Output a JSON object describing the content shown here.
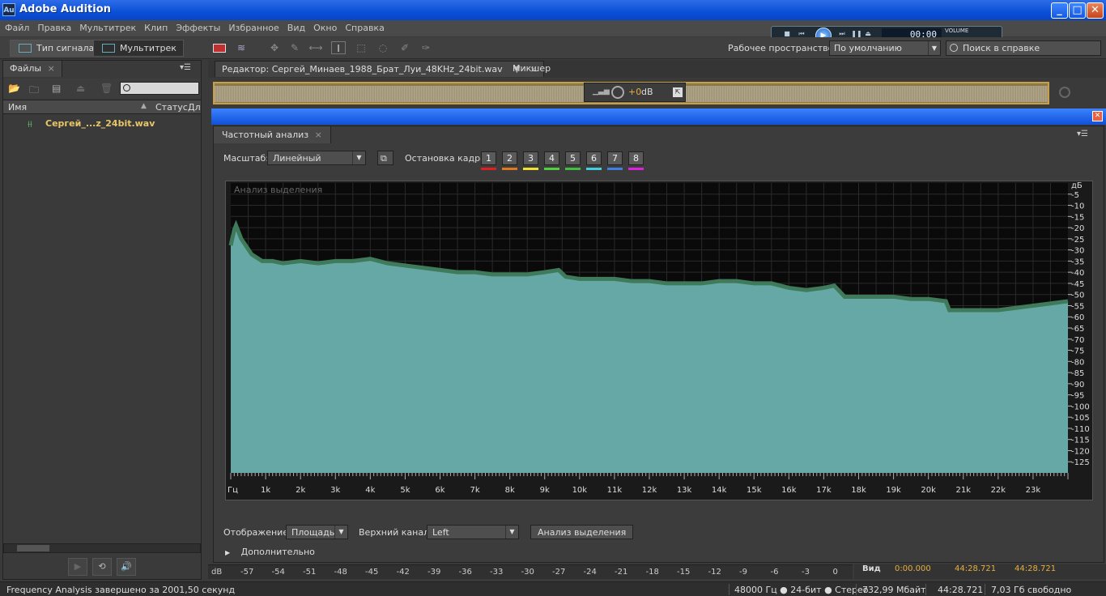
{
  "window": {
    "title": "Adobe Audition",
    "logo": "Au",
    "minimize": "_",
    "maximize": "□",
    "close": "✕"
  },
  "menu": [
    "Файл",
    "Правка",
    "Мультитрек",
    "Клип",
    "Эффекты",
    "Избранное",
    "Вид",
    "Окно",
    "Справка"
  ],
  "transport": {
    "time": "00:00",
    "volume_label": "VOLUME"
  },
  "toolbar": {
    "mode_waveform": "Тип сигнала",
    "mode_multitrack": "Мультитрек",
    "workspace_label": "Рабочее пространство:",
    "workspace_value": "По умолчанию",
    "help_placeholder": "Поиск в справке"
  },
  "files_panel": {
    "tab": "Файлы",
    "col_name": "Имя",
    "col_status": "Статус",
    "col_duration": "Дл",
    "file_name": "Сергей_...z_24bit.wav"
  },
  "editor": {
    "tab_editor": "Редактор: Сергей_Минаев_1988_Брат_Луи_48KHz_24bit.wav",
    "tab_mixer": "Микшер",
    "hud_gain": "+0",
    "hud_unit": "dB"
  },
  "freq_analysis": {
    "tab": "Частотный анализ",
    "scale_label": "Масштаб:",
    "scale_value": "Линейный",
    "hold_label": "Остановка кадра:",
    "hold_buttons": [
      "1",
      "2",
      "3",
      "4",
      "5",
      "6",
      "7",
      "8"
    ],
    "hold_colors": [
      "#e02020",
      "#e07820",
      "#f0e030",
      "#50d040",
      "#40c040",
      "#40d0e0",
      "#4080e0",
      "#e020e0"
    ],
    "chart_caption": "Анализ выделения",
    "display_label": "Отображение:",
    "display_value": "Площадь",
    "channel_label": "Верхний канал:",
    "channel_value": "Left",
    "analyze_button": "Анализ выделения",
    "advanced_label": "Дополнительно"
  },
  "chart_data": {
    "type": "area",
    "x_unit": "Гц",
    "y_unit": "дБ",
    "x_ticks": [
      "1k",
      "2k",
      "3k",
      "4k",
      "5k",
      "6k",
      "7k",
      "8k",
      "9k",
      "10k",
      "11k",
      "12k",
      "13k",
      "14k",
      "15k",
      "16k",
      "17k",
      "18k",
      "19k",
      "20k",
      "21k",
      "22k",
      "23k"
    ],
    "y_ticks": [
      "-5",
      "-10",
      "-15",
      "-20",
      "-25",
      "-30",
      "-35",
      "-40",
      "-45",
      "-50",
      "-55",
      "-60",
      "-65",
      "-70",
      "-75",
      "-80",
      "-85",
      "-90",
      "-95",
      "-100",
      "-105",
      "-110",
      "-115",
      "-120",
      "-125"
    ],
    "xlim": [
      0,
      24000
    ],
    "ylim": [
      -130,
      0
    ],
    "x": [
      0,
      100,
      150,
      300,
      600,
      900,
      1200,
      1500,
      2000,
      2500,
      3000,
      3500,
      4000,
      4500,
      5000,
      5500,
      6000,
      6500,
      7000,
      7500,
      8000,
      8500,
      9000,
      9400,
      9600,
      10000,
      10500,
      11000,
      11500,
      12000,
      12500,
      13000,
      13500,
      14000,
      14500,
      15000,
      15500,
      16000,
      16500,
      17000,
      17300,
      17600,
      18000,
      18500,
      19000,
      19500,
      20000,
      20500,
      20600,
      21000,
      21500,
      22000,
      22500,
      23000,
      23500,
      24000
    ],
    "y": [
      -28,
      -21,
      -19,
      -25,
      -32,
      -35,
      -35,
      -36,
      -35,
      -36,
      -35,
      -35,
      -34,
      -36,
      -37,
      -38,
      -39,
      -40,
      -40,
      -41,
      -41,
      -41,
      -40,
      -39,
      -42,
      -43,
      -43,
      -43,
      -44,
      -44,
      -45,
      -45,
      -45,
      -44,
      -44,
      -45,
      -45,
      -47,
      -48,
      -47,
      -46,
      -51,
      -51,
      -51,
      -51,
      -52,
      -52,
      -53,
      -57,
      -57,
      -57,
      -57,
      -56,
      -55,
      -54,
      -53
    ],
    "grid": true
  },
  "meter": {
    "unit": "dB",
    "ticks": [
      "-57",
      "-54",
      "-51",
      "-48",
      "-45",
      "-42",
      "-39",
      "-36",
      "-33",
      "-30",
      "-27",
      "-24",
      "-21",
      "-18",
      "-15",
      "-12",
      "-9",
      "-6",
      "-3",
      "0"
    ]
  },
  "selection_info": {
    "label": "Вид",
    "start": "0:00.000",
    "end": "44:28.721",
    "duration": "44:28.721"
  },
  "status": {
    "message": "Frequency Analysis завершено за 2001,50 секунд",
    "format": "48000 Гц ● 24-бит ● Стерео",
    "size": "732,99 Мбайт",
    "duration": "44:28.721",
    "free": "7,03 Гб свободно"
  }
}
